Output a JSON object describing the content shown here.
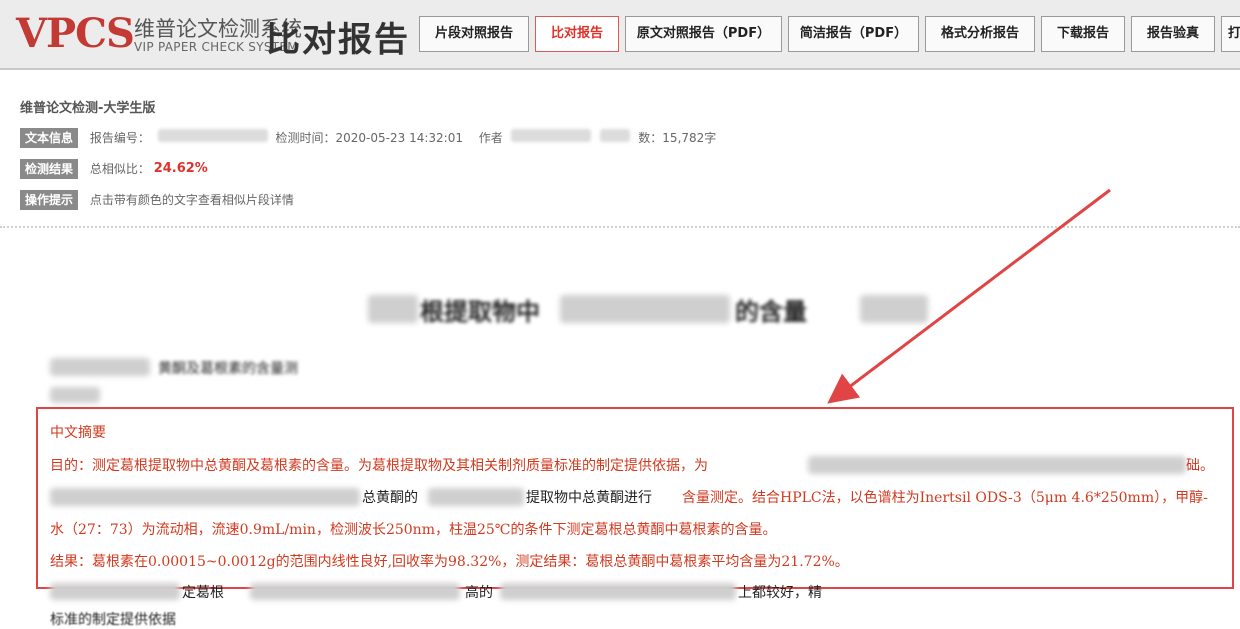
{
  "header": {
    "logo_mark": "VPCS",
    "logo_cn": "维普论文检测系统",
    "logo_en": "VIP PAPER CHECK SYSTEM",
    "page_title": "比对报告",
    "nav": [
      {
        "label": "片段对照报告",
        "active": false
      },
      {
        "label": "比对报告",
        "active": true
      },
      {
        "label": "原文对照报告（PDF）",
        "active": false
      },
      {
        "label": "简洁报告（PDF）",
        "active": false
      },
      {
        "label": "格式分析报告",
        "active": false
      },
      {
        "label": "下载报告",
        "active": false
      },
      {
        "label": "报告验真",
        "active": false
      },
      {
        "label": "打",
        "active": false
      }
    ]
  },
  "info": {
    "edition": "维普论文检测-大学生版",
    "text_info_tag": "文本信息",
    "report_no_label": "报告编号：",
    "check_time_label": "检测时间：2020-05-23 14:32:01",
    "author_label": "作者",
    "word_count_label": "数：15,782字",
    "result_tag": "检测结果",
    "similarity_label": "总相似比：",
    "similarity_value": "24.62%",
    "tip_tag": "操作提示",
    "tip_text": "点击带有颜色的文字查看相似片段详情"
  },
  "document": {
    "title_fragment_1": "根提取物中",
    "title_fragment_2": "的含量",
    "subtitle_fragment": "黄酮及葛根素的含量测",
    "abstract_heading": "中文摘要",
    "line1": "目的：测定葛根提取物中总黄酮及葛根素的含量。为葛根提取物及其相关制剂质量标准的制定提供依据，为",
    "line1_end": "础。",
    "line2_dark1": "总黄酮的",
    "line2_dark2": "提取物中总黄酮进行",
    "line2_red": "含量测定。结合HPLC法，以色谱柱为Inertsil ODS-3（5μm 4.6*250mm），甲醇-",
    "line3": "水（27：73）为流动相，流速0.9mL/min，检测波长250nm，柱温25℃的条件下测定葛根总黄酮中葛根素的含量。",
    "line4": "结果：葛根素在0.00015~0.0012g的范围内线性良好,回收率为98.32%，测定结果：葛根总黄酮中葛根素平均含量为21.72%。",
    "line5_frag1": "定葛根",
    "line5_frag2": "高的",
    "line5_frag3": "上都较好，精",
    "line6": "标准的制定提供依据"
  },
  "colors": {
    "accent_red": "#e0312b",
    "box_red": "#e14444",
    "tag_gray": "#8a8a8a"
  }
}
